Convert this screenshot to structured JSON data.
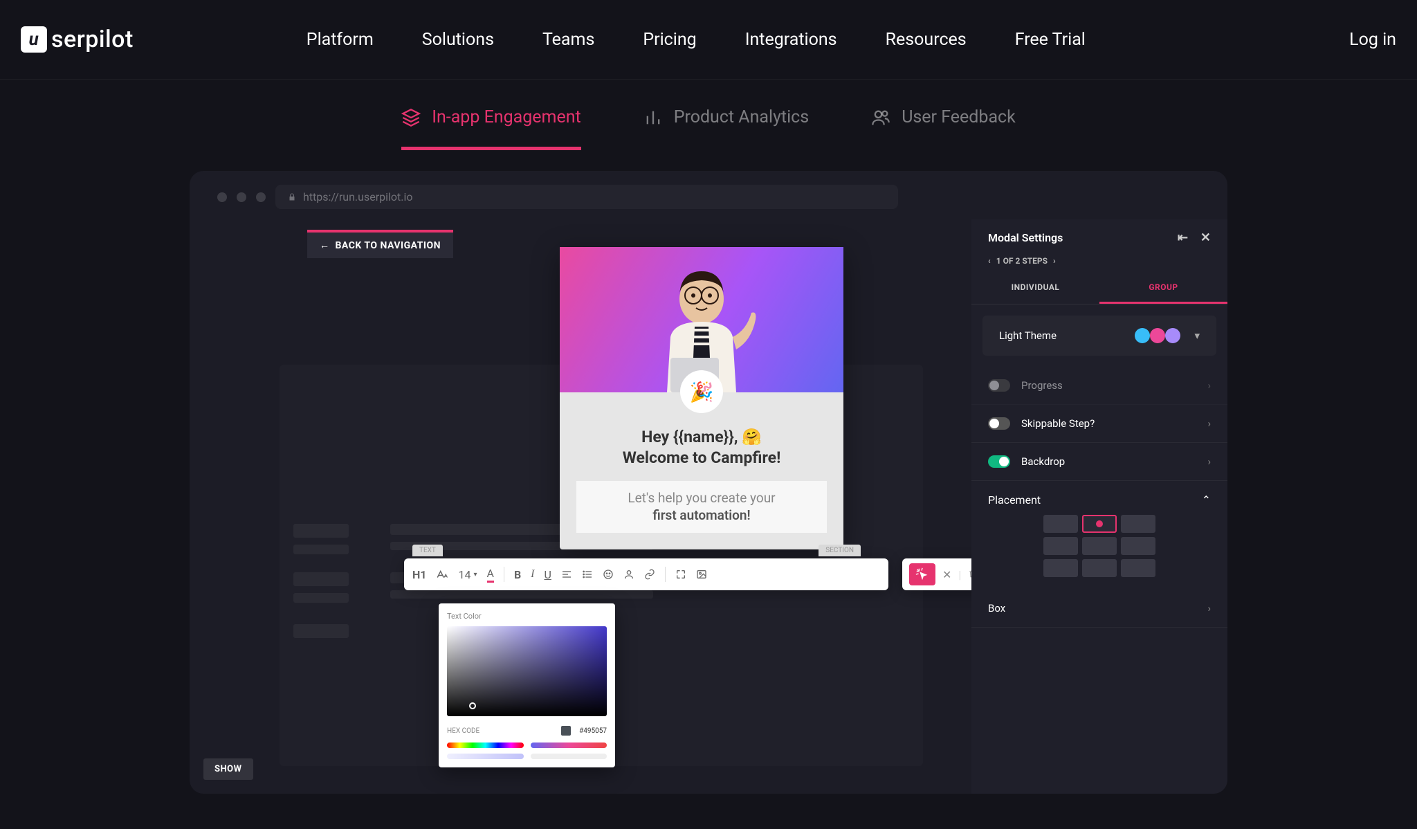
{
  "logo": "serpilot",
  "nav": [
    "Platform",
    "Solutions",
    "Teams",
    "Pricing",
    "Integrations",
    "Resources",
    "Free Trial"
  ],
  "login": "Log in",
  "tabs": [
    {
      "label": "In-app Engagement",
      "active": true
    },
    {
      "label": "Product Analytics",
      "active": false
    },
    {
      "label": "User Feedback",
      "active": false
    }
  ],
  "browser_url": "https://run.userpilot.io",
  "back_nav": "BACK TO NAVIGATION",
  "card": {
    "heading_line1": "Hey {{name}}, 🤗",
    "heading_line2": "Welcome to Campfire!",
    "sub_line1": "Let's help you create your",
    "sub_line2": "first automation!"
  },
  "toolbar": {
    "tag_left": "TEXT",
    "tag_right": "SECTION",
    "h1": "H1",
    "size": "14"
  },
  "colorpicker": {
    "title": "Text Color",
    "hex_label": "HEX CODE",
    "hex_value": "#495057"
  },
  "panel": {
    "title": "Modal Settings",
    "steps": "1 OF 2 STEPS",
    "tab_individual": "INDIVIDUAL",
    "tab_group": "GROUP",
    "theme": "Light Theme",
    "progress": "Progress",
    "skippable": "Skippable Step?",
    "backdrop": "Backdrop",
    "placement": "Placement",
    "box": "Box"
  },
  "show": "SHOW"
}
